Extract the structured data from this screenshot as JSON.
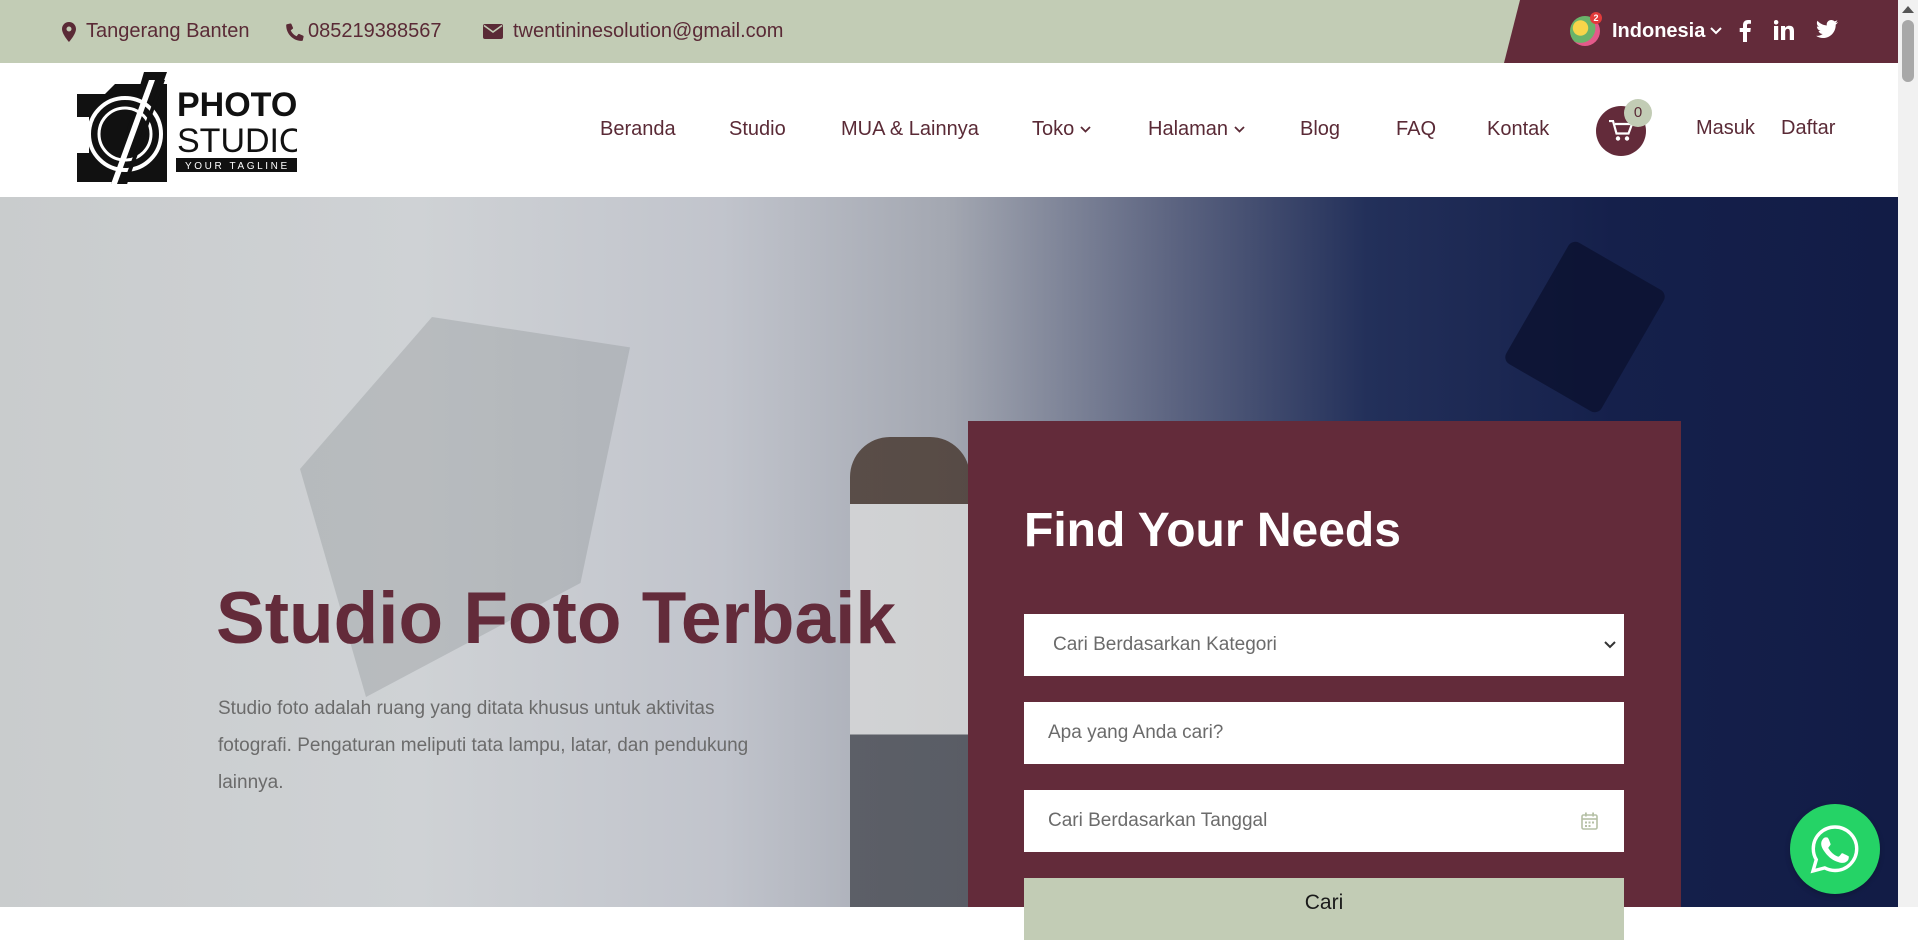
{
  "topbar": {
    "location": "Tangerang Banten",
    "phone": "085219388567",
    "email": "twentininesolution@gmail.com",
    "language": "Indonesia"
  },
  "header": {
    "logo": {
      "line1": "PHOTO",
      "line2": "STUDIO",
      "tagline": "YOUR TAGLINE"
    },
    "nav": {
      "beranda": "Beranda",
      "studio": "Studio",
      "mua": "MUA & Lainnya",
      "toko": "Toko",
      "halaman": "Halaman",
      "blog": "Blog",
      "faq": "FAQ",
      "kontak": "Kontak"
    },
    "cart_count": "0",
    "login": "Masuk",
    "register": "Daftar"
  },
  "hero": {
    "title": "Studio Foto Terbaik",
    "description": "Studio foto adalah ruang yang ditata khusus untuk aktivitas fotografi. Pengaturan meliputi tata lampu, latar, dan pendukung lainnya."
  },
  "search": {
    "title": "Find Your Needs",
    "category_selected": "Cari Berdasarkan Kategori",
    "keyword_placeholder": "Apa yang Anda cari?",
    "date_placeholder": "Cari Berdasarkan Tanggal",
    "button": "Cari"
  },
  "colors": {
    "brand": "#632b3a",
    "accent": "#c2ccb5",
    "whatsapp": "#25d366"
  },
  "icons": [
    "map-marker-icon",
    "phone-icon",
    "envelope-icon",
    "flag-icon",
    "chevron-down-icon",
    "facebook-icon",
    "linkedin-icon",
    "twitter-icon",
    "cart-icon",
    "calendar-icon",
    "whatsapp-icon"
  ]
}
